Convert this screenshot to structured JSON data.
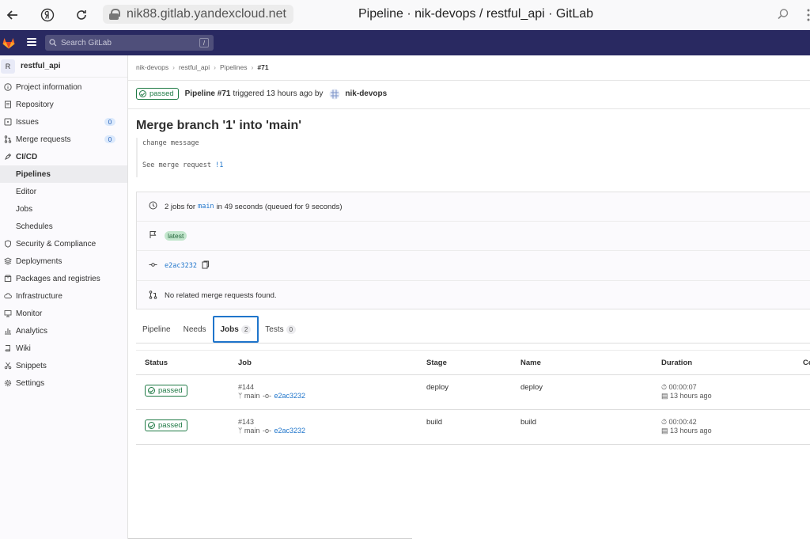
{
  "browser": {
    "url": "nik88.gitlab.yandexcloud.net",
    "tab_title": "Pipeline · nik-devops / restful_api · GitLab"
  },
  "header": {
    "search_placeholder": "Search GitLab",
    "search_shortcut": "/"
  },
  "sidebar": {
    "project_initial": "R",
    "project_name": "restful_api",
    "items": [
      {
        "label": "Project information",
        "icon": "info-icon"
      },
      {
        "label": "Repository",
        "icon": "doc-icon"
      },
      {
        "label": "Issues",
        "icon": "issues-icon",
        "count": "0"
      },
      {
        "label": "Merge requests",
        "icon": "merge-request-icon",
        "count": "0"
      },
      {
        "label": "CI/CD",
        "icon": "rocket-icon"
      },
      {
        "label": "Pipelines"
      },
      {
        "label": "Editor"
      },
      {
        "label": "Jobs"
      },
      {
        "label": "Schedules"
      },
      {
        "label": "Security & Compliance",
        "icon": "shield-icon"
      },
      {
        "label": "Deployments",
        "icon": "deployments-icon"
      },
      {
        "label": "Packages and registries",
        "icon": "package-icon"
      },
      {
        "label": "Infrastructure",
        "icon": "cloud-icon"
      },
      {
        "label": "Monitor",
        "icon": "monitor-icon"
      },
      {
        "label": "Analytics",
        "icon": "chart-icon"
      },
      {
        "label": "Wiki",
        "icon": "book-icon"
      },
      {
        "label": "Snippets",
        "icon": "scissors-icon"
      },
      {
        "label": "Settings",
        "icon": "gear-icon"
      }
    ]
  },
  "breadcrumb": [
    "nik-devops",
    "restful_api",
    "Pipelines",
    "#71"
  ],
  "pipeline": {
    "status": "passed",
    "label": "Pipeline #71",
    "triggered_text": "triggered 13 hours ago by",
    "user": "nik-devops"
  },
  "commit": {
    "title": "Merge branch '1' into 'main'",
    "message": "change message",
    "see_mr_text": "See merge request",
    "mr_ref": "!1"
  },
  "info": {
    "jobs_prefix": "2 jobs for",
    "branch": "main",
    "jobs_suffix": "in 49 seconds (queued for 9 seconds)",
    "badge": "latest",
    "sha": "e2ac3232",
    "mr_text": "No related merge requests found."
  },
  "tabs": [
    {
      "label": "Pipeline"
    },
    {
      "label": "Needs"
    },
    {
      "label": "Jobs",
      "count": "2"
    },
    {
      "label": "Tests",
      "count": "0"
    }
  ],
  "table": {
    "headers": [
      "Status",
      "Job",
      "Stage",
      "Name",
      "Duration",
      "Co"
    ],
    "rows": [
      {
        "status": "passed",
        "id": "#144",
        "branch": "main",
        "sha": "e2ac3232",
        "stage": "deploy",
        "name": "deploy",
        "duration": "00:00:07",
        "finished": "13 hours ago"
      },
      {
        "status": "passed",
        "id": "#143",
        "branch": "main",
        "sha": "e2ac3232",
        "stage": "build",
        "name": "build",
        "duration": "00:00:42",
        "finished": "13 hours ago"
      }
    ]
  },
  "colors": {
    "header_bg": "#292961",
    "success": "#1f7a45",
    "link": "#1f75cb"
  }
}
